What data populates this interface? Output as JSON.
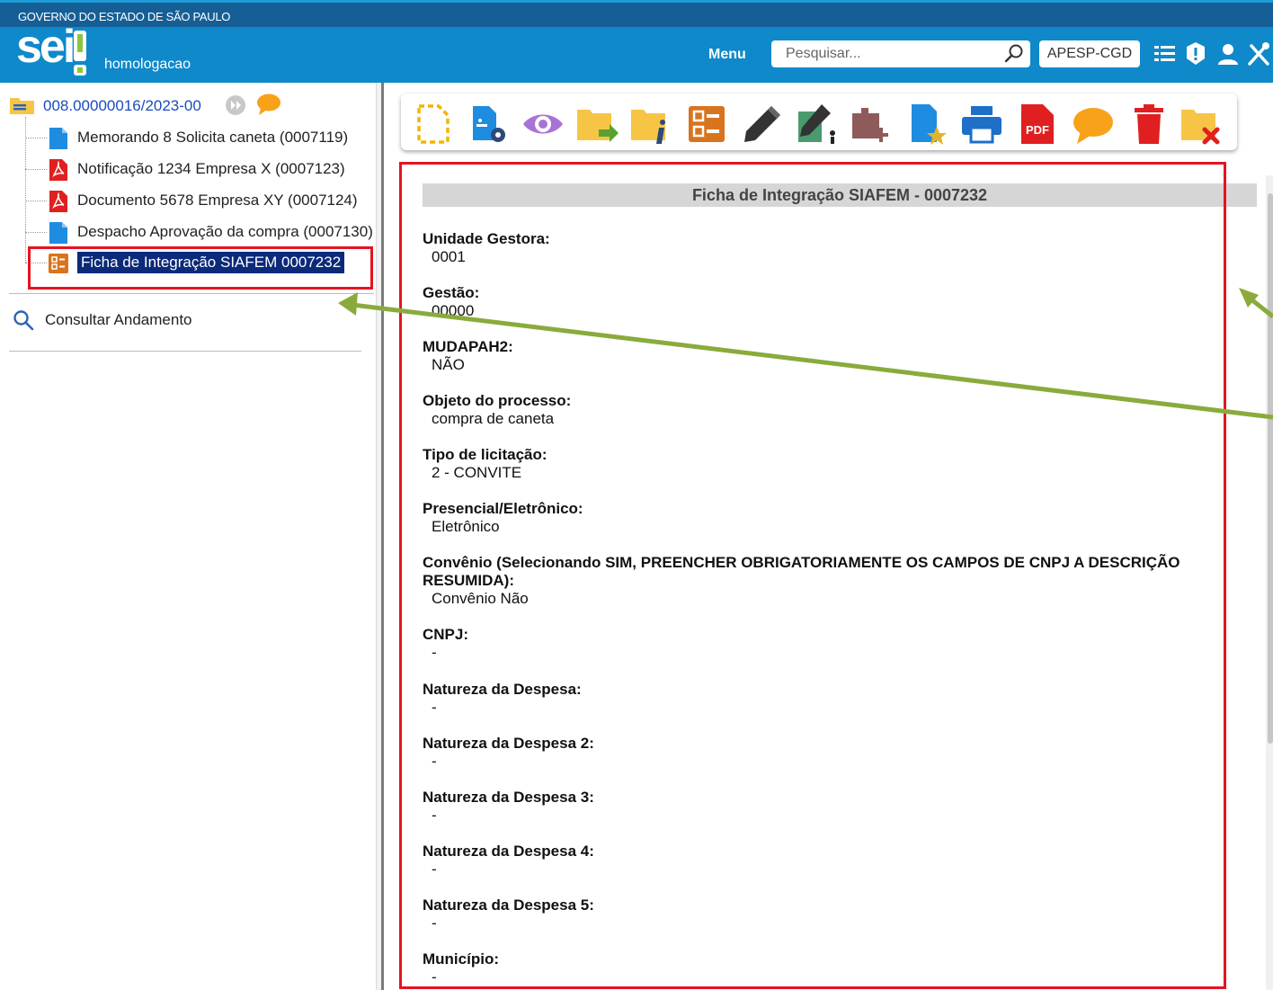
{
  "header": {
    "gov_title": "GOVERNO DO ESTADO DE SÃO PAULO",
    "logo_text": "sei",
    "environment": "homologacao",
    "menu_label": "Menu",
    "search_placeholder": "Pesquisar...",
    "unit_label": "APESP-CGD",
    "icons": [
      "list-icon",
      "alert-icon",
      "user-icon",
      "tools-icon"
    ]
  },
  "tree": {
    "process_number": "008.00000016/2023-00",
    "items": [
      {
        "label": "Memorando 8 Solicita caneta (0007119)",
        "icon": "document-icon"
      },
      {
        "label": "Notificação 1234 Empresa X (0007123)",
        "icon": "pdf-icon"
      },
      {
        "label": "Documento 5678 Empresa XY (0007124)",
        "icon": "pdf-icon"
      },
      {
        "label": "Despacho Aprovação da compra (0007130)",
        "icon": "document-icon"
      },
      {
        "label": "Ficha de Integração SIAFEM 0007232",
        "icon": "form-icon"
      }
    ],
    "consult_label": "Consultar Andamento"
  },
  "toolbar": {
    "icons": [
      "new-document-icon",
      "document-settings-icon",
      "view-icon",
      "send-process-icon",
      "process-info-icon",
      "form-icon",
      "sign-icon",
      "sign-block-icon",
      "add-block-icon",
      "favorite-document-icon",
      "print-icon",
      "pdf-icon",
      "comment-icon",
      "delete-icon",
      "close-process-icon"
    ]
  },
  "document": {
    "title": "Ficha de Integração SIAFEM - 0007232",
    "fields": [
      {
        "label": "Unidade Gestora:",
        "value": "0001"
      },
      {
        "label": "Gestão:",
        "value": "00000"
      },
      {
        "label": "MUDAPAH2:",
        "value": "NÃO"
      },
      {
        "label": "Objeto do processo:",
        "value": "compra de caneta"
      },
      {
        "label": "Tipo de licitação:",
        "value": "2 - CONVITE"
      },
      {
        "label": "Presencial/Eletrônico:",
        "value": "Eletrônico"
      },
      {
        "label": "Convênio (Selecionando SIM, PREENCHER OBRIGATORIAMENTE OS CAMPOS DE CNPJ A DESCRIÇÃO RESUMIDA):",
        "value": "Convênio Não"
      },
      {
        "label": "CNPJ:",
        "value": "-"
      },
      {
        "label": "Natureza da Despesa:",
        "value": "-"
      },
      {
        "label": "Natureza da Despesa 2:",
        "value": "-"
      },
      {
        "label": "Natureza da Despesa 3:",
        "value": "-"
      },
      {
        "label": "Natureza da Despesa 4:",
        "value": "-"
      },
      {
        "label": "Natureza da Despesa 5:",
        "value": "-"
      },
      {
        "label": "Município:",
        "value": "-"
      }
    ]
  },
  "colors": {
    "gov_bar": "#155f96",
    "header": "#0f89ca",
    "highlight_frame": "#e5141f",
    "annotation_arrow": "#8aab3c",
    "selection": "#0b2a7a",
    "link": "#1a4bc2"
  }
}
